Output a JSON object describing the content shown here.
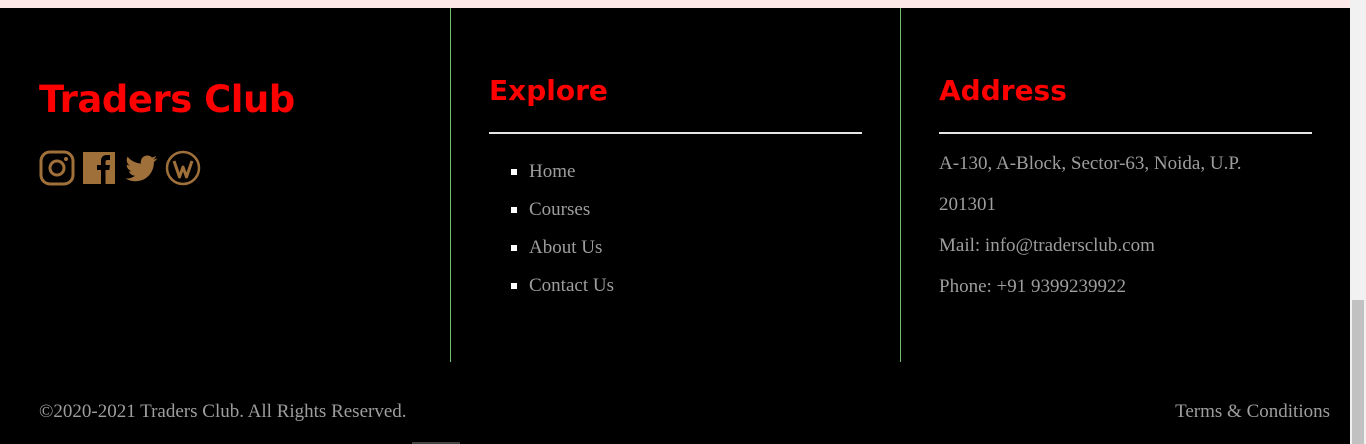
{
  "brand": {
    "name": "Traders Club",
    "accent_color": "#ff0000",
    "social_icon_color": "#a0703a",
    "social_icons": [
      "instagram-icon",
      "facebook-icon",
      "twitter-icon",
      "wordpress-icon"
    ]
  },
  "explore": {
    "title": "Explore",
    "links": [
      "Home",
      "Courses",
      "About Us",
      "Contact Us"
    ]
  },
  "address": {
    "title": "Address",
    "line1": "A-130, A-Block, Sector-63, Noida, U.P.",
    "line2": "201301",
    "mail": "Mail: info@tradersclub.com",
    "phone": "Phone: +91 9399239922"
  },
  "footer_bottom": {
    "copyright": "©2020-2021 Traders Club. All Rights Reserved.",
    "terms": "Terms & Conditions"
  },
  "colors": {
    "background": "#000000",
    "text_muted": "#9e9e9e",
    "divider": "#6fbf73",
    "top_strip": "#fde8e8"
  }
}
